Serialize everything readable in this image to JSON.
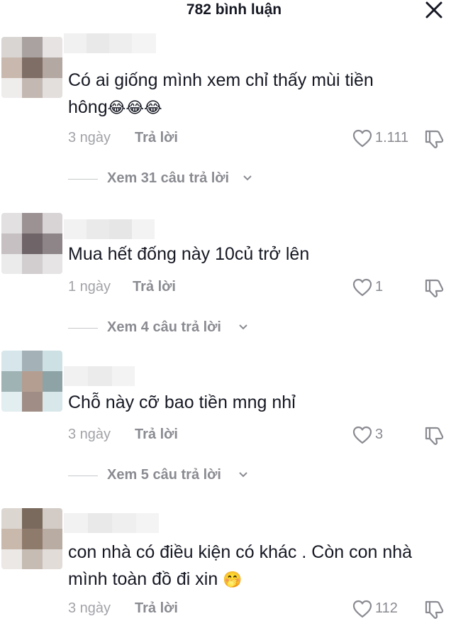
{
  "header": {
    "title": "782 bình luận",
    "close_icon": "close-icon"
  },
  "comments": [
    {
      "text_line1": "Có ai giống mình xem chỉ thấy mùi tiền",
      "text_line2": "hông",
      "emoji": "😂😂😂",
      "time": "3 ngày",
      "reply_label": "Trả lời",
      "likes": "1.111",
      "view_replies": "Xem 31 câu trả lời",
      "avatar_colors": [
        "#d9d5d3",
        "#a9a2a0",
        "#e6e3e2",
        "#c9b8ae",
        "#7e6e66",
        "#b3a8a2",
        "#efedec",
        "#c4b8b2",
        "#e3dfdd"
      ]
    },
    {
      "text_line1": "Mua hết đống này 10củ trở lên",
      "time": "1 ngày",
      "reply_label": "Trả lời",
      "likes": "1",
      "view_replies": "Xem 4 câu trả lời",
      "avatar_colors": [
        "#e2e0e1",
        "#9c9294",
        "#d8d4d6",
        "#c6c0c2",
        "#6f6568",
        "#8e8588",
        "#ecebec",
        "#d2ced0",
        "#e6e4e5"
      ]
    },
    {
      "text_line1": "Chỗ này cỡ bao tiền mng nhỉ",
      "time": "3 ngày",
      "reply_label": "Trả lời",
      "likes": "3",
      "view_replies": "Xem 5 câu trả lời",
      "avatar_colors": [
        "#d7e6ea",
        "#a4b1b6",
        "#cde0e3",
        "#9fb2b4",
        "#b49e92",
        "#8ea3a6",
        "#e3eef0",
        "#a08d86",
        "#d8e7ea"
      ]
    },
    {
      "text_line1": "con nhà có điều kiện có khác . Còn con nhà",
      "text_line2": "mình toàn đồ đi xin",
      "emoji": "🤭",
      "time": "3 ngày",
      "reply_label": "Trả lời",
      "likes": "112",
      "avatar_colors": [
        "#dcd6d1",
        "#7a6a5e",
        "#d3ccc6",
        "#c8b9ac",
        "#8f7b6c",
        "#b9aca2",
        "#ebe8e5",
        "#c6bcb4",
        "#e1dcd8"
      ]
    }
  ],
  "icons": {
    "like": "heart-outline-icon",
    "dislike": "thumb-down-icon",
    "chevron": "chevron-down-icon"
  },
  "colors": {
    "text": "#161823",
    "muted": "#8a8b91",
    "time": "#a2a3a8",
    "divider": "#c7c8cc"
  }
}
